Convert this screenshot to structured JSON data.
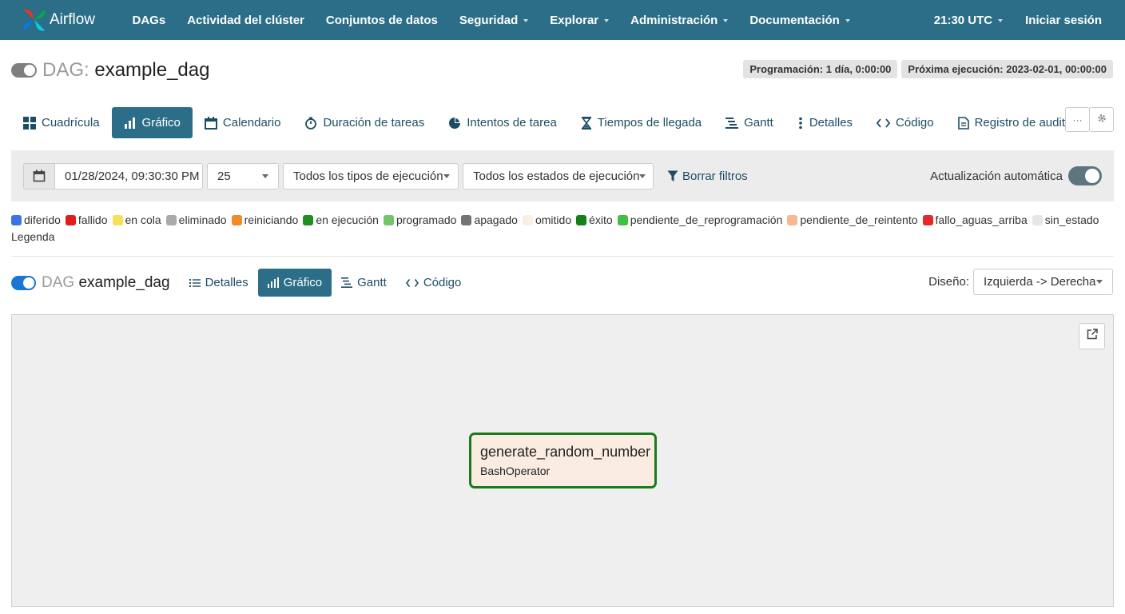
{
  "nav": {
    "brand": "Airflow",
    "items": [
      "DAGs",
      "Actividad del clúster",
      "Conjuntos de datos",
      "Seguridad",
      "Explorar",
      "Administración",
      "Documentación"
    ],
    "time": "21:30 UTC",
    "login": "Iniciar sesión"
  },
  "dag": {
    "prefix": "DAG:",
    "name": "example_dag",
    "schedule_badge": "Programación: 1 día, 0:00:00",
    "next_run_badge": "Próxima ejecución: 2023-02-01, 00:00:00"
  },
  "tabs": [
    "Cuadrícula",
    "Gráfico",
    "Calendario",
    "Duración de tareas",
    "Intentos de tarea",
    "Tiempos de llegada",
    "Gantt",
    "Detalles",
    "Código",
    "Registro de auditoría"
  ],
  "active_tab": "Gráfico",
  "more_button": "···",
  "filters": {
    "base_date": "01/28/2024, 09:30:30 PM",
    "num_runs": "25",
    "run_type": "Todos los tipos de ejecución",
    "run_state": "Todos los estados de ejecución",
    "clear": "Borrar filtros",
    "auto_refresh": "Actualización automática"
  },
  "legend": {
    "title": "Legenda",
    "items": [
      {
        "label": "diferido",
        "color": "#3d74e3"
      },
      {
        "label": "fallido",
        "color": "#e41b1b"
      },
      {
        "label": "en cola",
        "color": "#f5e05a"
      },
      {
        "label": "eliminado",
        "color": "#a9a9a9"
      },
      {
        "label": "reiniciando",
        "color": "#f28a2a"
      },
      {
        "label": "en ejecución",
        "color": "#1f8f1f"
      },
      {
        "label": "programado",
        "color": "#74c36d"
      },
      {
        "label": "apagado",
        "color": "#747474"
      },
      {
        "label": "omitido",
        "color": "#fbefe4"
      },
      {
        "label": "éxito",
        "color": "#15801a"
      },
      {
        "label": "pendiente_de_reprogramación",
        "color": "#40c040"
      },
      {
        "label": "pendiente_de_reintento",
        "color": "#f6b98e"
      },
      {
        "label": "fallo_aguas_arriba",
        "color": "#e62828"
      },
      {
        "label": "sin_estado",
        "color": "#e6e6e6"
      }
    ]
  },
  "graph_header": {
    "prefix": "DAG",
    "name": "example_dag",
    "tabs": [
      "Detalles",
      "Gráfico",
      "Gantt",
      "Código"
    ],
    "active_tab": "Gráfico",
    "layout_label": "Diseño:",
    "layout_value": "Izquierda -> Derecha"
  },
  "node": {
    "task_id": "generate_random_number",
    "operator": "BashOperator",
    "border_color": "#1b7a1b",
    "fill_color": "#fbece1"
  }
}
